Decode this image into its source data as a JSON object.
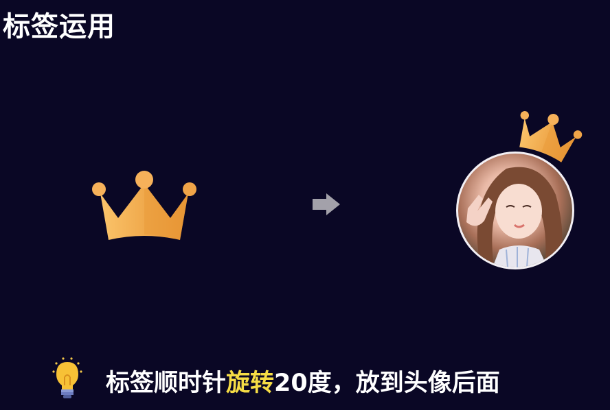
{
  "title": "标签运用",
  "caption": {
    "part1": "标签顺时针",
    "highlight": "旋转",
    "part2": "20度，放到头像后面"
  },
  "colors": {
    "background": "#0a0725",
    "crown_light": "#f7b45a",
    "crown_dark": "#e58f2e",
    "highlight": "#f6dd45",
    "arrow": "#a3a1aa"
  },
  "icons": {
    "crown": "crown-icon",
    "arrow": "arrow-right-icon",
    "tip": "lightbulb-icon"
  }
}
